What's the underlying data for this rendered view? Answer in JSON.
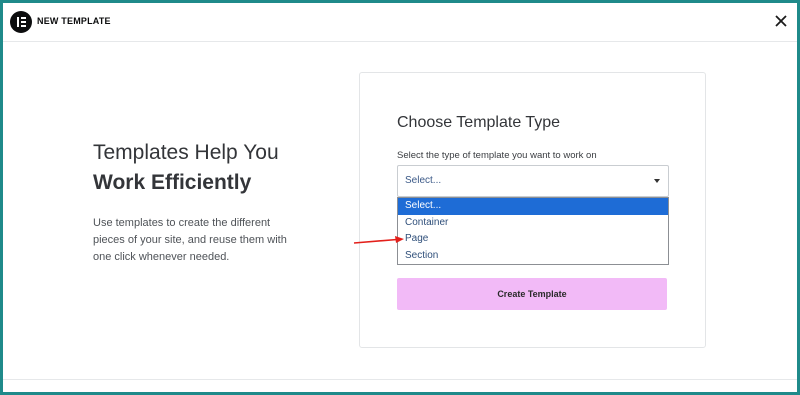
{
  "header": {
    "title": "NEW TEMPLATE",
    "logo_icon": "elementor-logo-icon",
    "close_icon": "close-icon"
  },
  "intro": {
    "title_line1": "Templates Help You",
    "title_line2": "Work Efficiently",
    "description": "Use templates to create the different pieces of your site, and reuse them with one click whenever needed."
  },
  "form": {
    "title": "Choose Template Type",
    "select_label": "Select the type of template you want to work on",
    "select_value": "Select...",
    "options": [
      "Select...",
      "Container",
      "Page",
      "Section"
    ],
    "selected_option": "Select...",
    "create_button": "Create Template"
  },
  "annotation": {
    "arrow_color": "#e3201b"
  },
  "colors": {
    "page_border": "#1f8a8a",
    "button_bg": "#f2baf7",
    "selected_option_bg": "#1e6cd6"
  }
}
